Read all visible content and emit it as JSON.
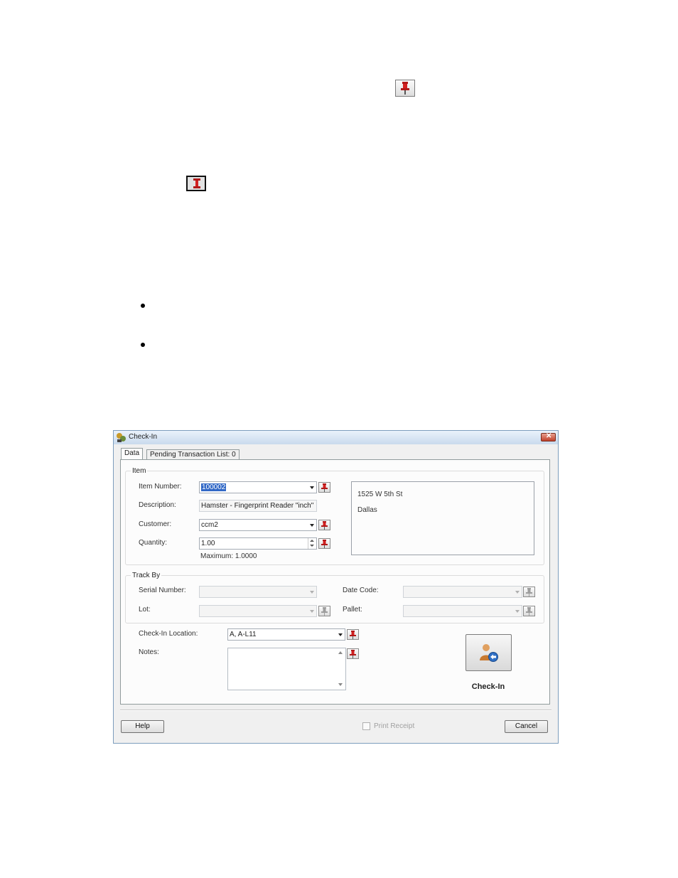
{
  "dialog": {
    "title": "Check-In",
    "tabs": [
      {
        "label": "Data"
      },
      {
        "label": "Pending Transaction List: 0"
      }
    ],
    "item_group": {
      "label": "Item",
      "item_number_label": "Item Number:",
      "item_number_value": "100002",
      "description_label": "Description:",
      "description_value": "Hamster - Fingerprint Reader \"inch\"",
      "customer_label": "Customer:",
      "customer_value": "ccm2",
      "quantity_label": "Quantity:",
      "quantity_value": "1.00",
      "maximum_text": "Maximum: 1.0000",
      "address_line1": "1525  W  5th St",
      "address_line2": "Dallas"
    },
    "track_group": {
      "label": "Track By",
      "serial_label": "Serial Number:",
      "date_code_label": "Date Code:",
      "lot_label": "Lot:",
      "pallet_label": "Pallet:"
    },
    "checkin_location_label": "Check-In Location:",
    "checkin_location_value": "A, A-L11",
    "notes_label": "Notes:",
    "checkin_button_label": "Check-In",
    "help_label": "Help",
    "print_receipt_label": "Print Receipt",
    "print_receipt_checked": false,
    "cancel_label": "Cancel"
  },
  "icons": {
    "pin": "push-pin-icon",
    "checkin": "person-arrow-icon",
    "close": "close-icon"
  },
  "colors": {
    "pin_red": "#d42020",
    "selection_blue": "#3168c6",
    "titlebar": "#c9daed"
  }
}
